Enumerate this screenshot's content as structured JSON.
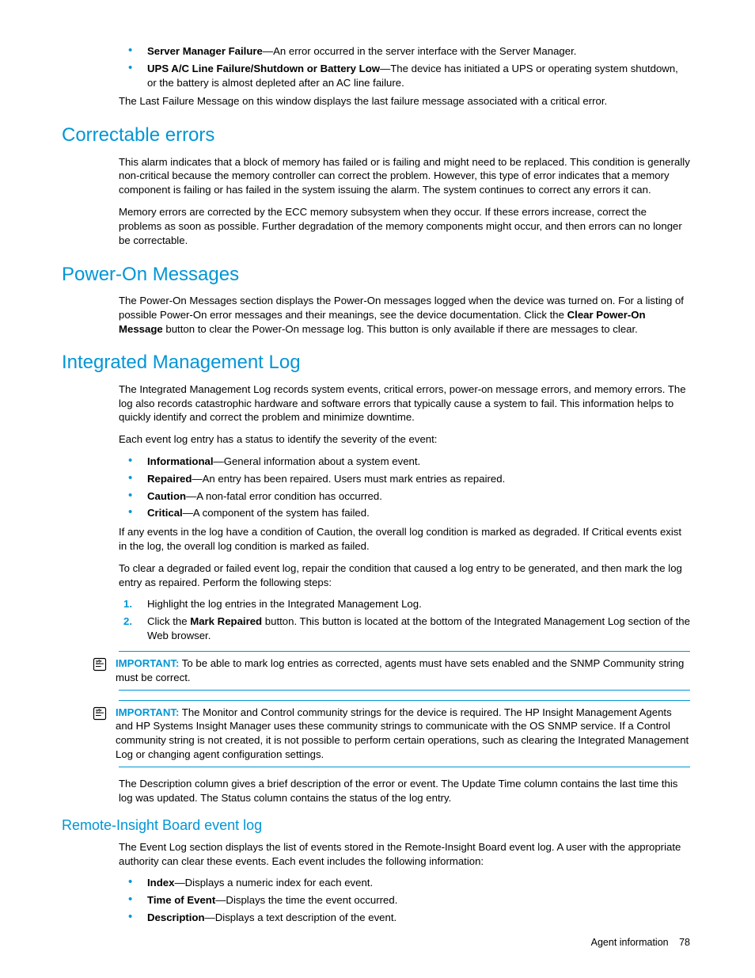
{
  "top_bullets": [
    {
      "term": "Server Manager Failure",
      "desc": "—An error occurred in the server interface with the Server Manager."
    },
    {
      "term": "UPS A/C Line Failure/Shutdown or Battery Low",
      "desc": "—The device has initiated a UPS or operating system shutdown, or the battery is almost depleted after an AC line failure."
    }
  ],
  "top_para": "The Last Failure Message on this window displays the last failure message associated with a critical error.",
  "s1": {
    "heading": "Correctable errors",
    "p1": "This alarm indicates that a block of memory has failed or is failing and might need to be replaced. This condition is generally non-critical because the memory controller can correct the problem. However, this type of error indicates that a memory component is failing or has failed in the system issuing the alarm. The system continues to correct any errors it can.",
    "p2": "Memory errors are corrected by the ECC memory subsystem when they occur. If these errors increase, correct the problems as soon as possible. Further degradation of the memory components might occur, and then errors can no longer be correctable."
  },
  "s2": {
    "heading": "Power-On Messages",
    "p1_pre": "The Power-On Messages section displays the Power-On messages logged when the device was turned on. For a listing of possible Power-On error messages and their meanings, see the device documentation. Click the ",
    "p1_bold": "Clear Power-On Message",
    "p1_post": " button to clear the Power-On message log. This button is only available if there are messages to clear."
  },
  "s3": {
    "heading": "Integrated Management Log",
    "p1": "The Integrated Management Log records system events, critical errors, power-on message errors, and memory errors. The log also records catastrophic hardware and software errors that typically cause a system to fail. This information helps to quickly identify and correct the problem and minimize downtime.",
    "p2": "Each event log entry has a status to identify the severity of the event:",
    "bullets": [
      {
        "term": "Informational",
        "desc": "—General information about a system event."
      },
      {
        "term": "Repaired",
        "desc": "—An entry has been repaired. Users must mark entries as repaired."
      },
      {
        "term": "Caution",
        "desc": "—A non-fatal error condition has occurred."
      },
      {
        "term": "Critical",
        "desc": "—A component of the system has failed."
      }
    ],
    "p3": "If any events in the log have a condition of Caution, the overall log condition is marked as degraded. If Critical events exist in the log, the overall log condition is marked as failed.",
    "p4": "To clear a degraded or failed event log, repair the condition that caused a log entry to be generated, and then mark the log entry as repaired. Perform the following steps:",
    "steps": [
      {
        "num": "1.",
        "text": "Highlight the log entries in the Integrated Management Log."
      },
      {
        "num": "2.",
        "pre": "Click the ",
        "bold": "Mark Repaired",
        "post": " button. This button is located at the bottom of the Integrated Management Log section of the Web browser."
      }
    ],
    "note1_label": "IMPORTANT:",
    "note1_text": " To be able to mark log entries as corrected, agents must have sets enabled and the SNMP Community string must be correct.",
    "note2_label": "IMPORTANT:",
    "note2_text": " The Monitor and Control community strings for the device is required. The HP Insight Management Agents and HP Systems Insight Manager uses these community strings to communicate with the OS SNMP service. If a Control community string is not created, it is not possible to perform certain operations, such as clearing the Integrated Management Log or changing agent configuration settings.",
    "p5": "The Description column gives a brief description of the error or event. The Update Time column contains the last time this log was updated. The Status column contains the status of the log entry."
  },
  "s4": {
    "heading": "Remote-Insight Board event log",
    "p1": "The Event Log section displays the list of events stored in the Remote-Insight Board event log. A user with the appropriate authority can clear these events. Each event includes the following information:",
    "bullets": [
      {
        "term": "Index",
        "desc": "—Displays a numeric index for each event."
      },
      {
        "term": "Time of Event",
        "desc": "—Displays the time the event occurred."
      },
      {
        "term": "Description",
        "desc": "—Displays a text description of the event."
      }
    ]
  },
  "footer": {
    "section": "Agent information",
    "page": "78"
  }
}
